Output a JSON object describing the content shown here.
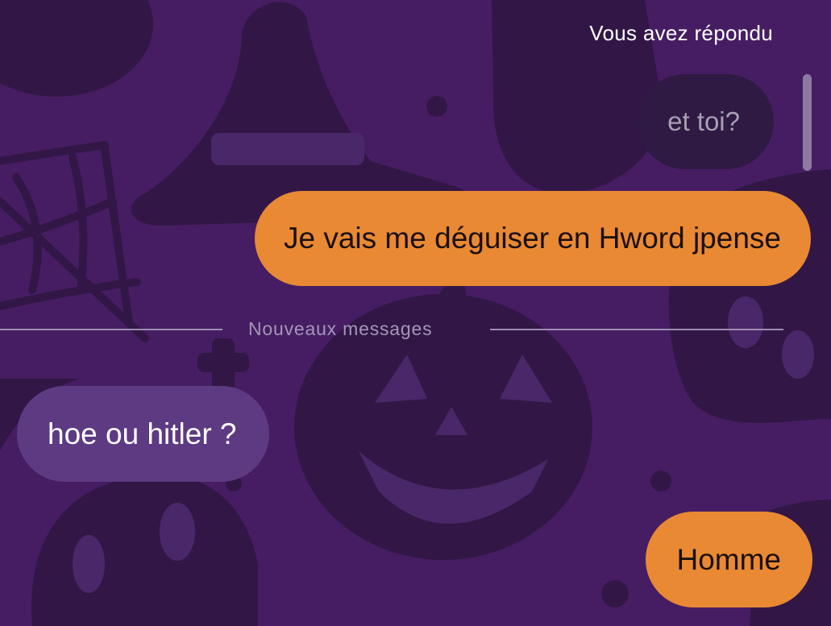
{
  "conversation": {
    "replied_label": "Vous avez répondu",
    "quoted_message": "et toi?",
    "sent_message_1": "Je vais me déguiser en Hword jpense",
    "new_messages_label": "Nouveaux messages",
    "received_message": "hoe ou hitler ?",
    "sent_message_2": "Homme"
  },
  "theme": {
    "background": "#461d62",
    "pattern": "#321746",
    "outgoing_bubble": "#e98934",
    "incoming_bubble": "#5e3a82",
    "quoted_bubble": "#2f1a43",
    "divider": "#9d8cb0"
  },
  "background_pattern": {
    "icons": [
      "witch-hat-icon",
      "spider-web-icon",
      "jack-o-lantern-icon",
      "skull-icon",
      "ghost-icon",
      "cross-icon"
    ]
  }
}
